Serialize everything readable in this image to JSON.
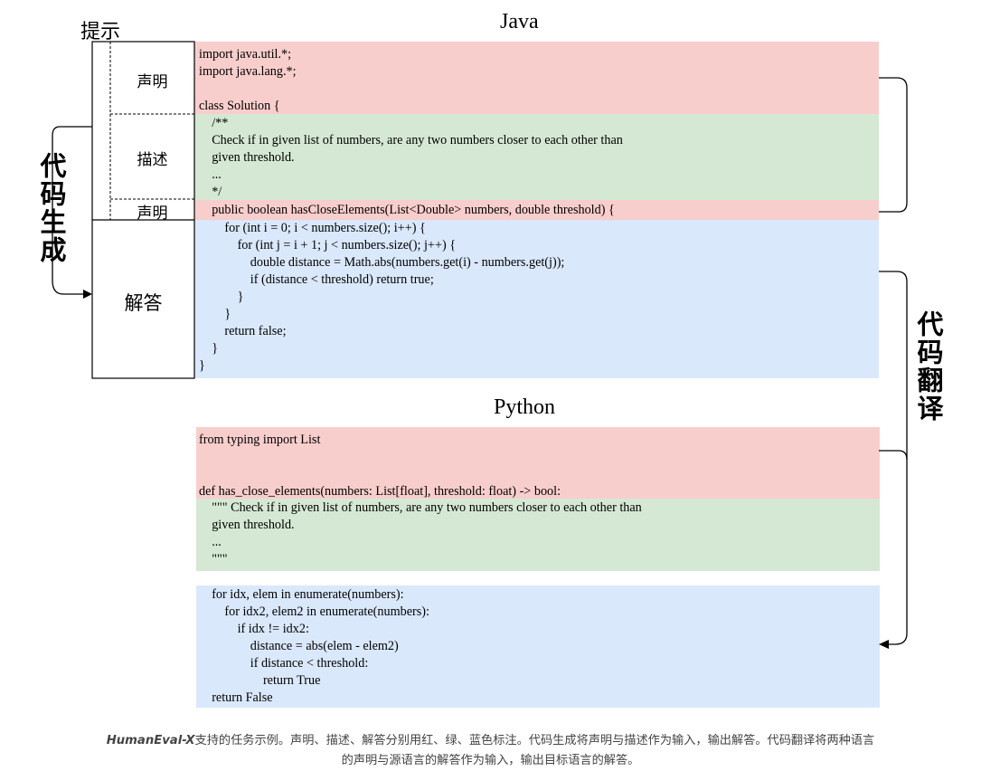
{
  "titles": {
    "java": "Java",
    "python": "Python",
    "prompt": "提示"
  },
  "labels": {
    "declaration_top": "声明",
    "description": "描述",
    "declaration_bottom": "声明",
    "solution": "解答",
    "code_generation": "代码生成",
    "code_translation": "代码翻译"
  },
  "java": {
    "declaration": "import java.util.*;\nimport java.lang.*;\n\nclass Solution {",
    "description": "    /**\n    Check if in given list of numbers, are any two numbers closer to each other than\n    given threshold.\n    ...\n    */",
    "signature": "    public boolean hasCloseElements(List<Double> numbers, double threshold) {",
    "solution": "        for (int i = 0; i < numbers.size(); i++) {\n            for (int j = i + 1; j < numbers.size(); j++) {\n                double distance = Math.abs(numbers.get(i) - numbers.get(j));\n                if (distance < threshold) return true;\n            }\n        }\n        return false;\n    }\n}"
  },
  "python": {
    "declaration": "from typing import List\n\n\ndef has_close_elements(numbers: List[float], threshold: float) -> bool:",
    "description": "    \"\"\" Check if in given list of numbers, are any two numbers closer to each other than\n    given threshold.\n    ...\n    \"\"\"",
    "solution": "    for idx, elem in enumerate(numbers):\n        for idx2, elem2 in enumerate(numbers):\n            if idx != idx2:\n                distance = abs(elem - elem2)\n                if distance < threshold:\n                    return True\n    return False"
  },
  "caption": {
    "lead": "HumanEval-X",
    "line1": "支持的任务示例。声明、描述、解答分别用红、绿、蓝色标注。代码生成将声明与描述作为输入，输出解答。代码翻译将两种语言",
    "line2": "的声明与源语言的解答作为输入，输出目标语言的解答。"
  },
  "colors": {
    "declaration": "#f8cecc",
    "description": "#d5e8d4",
    "solution": "#dae8fc"
  }
}
